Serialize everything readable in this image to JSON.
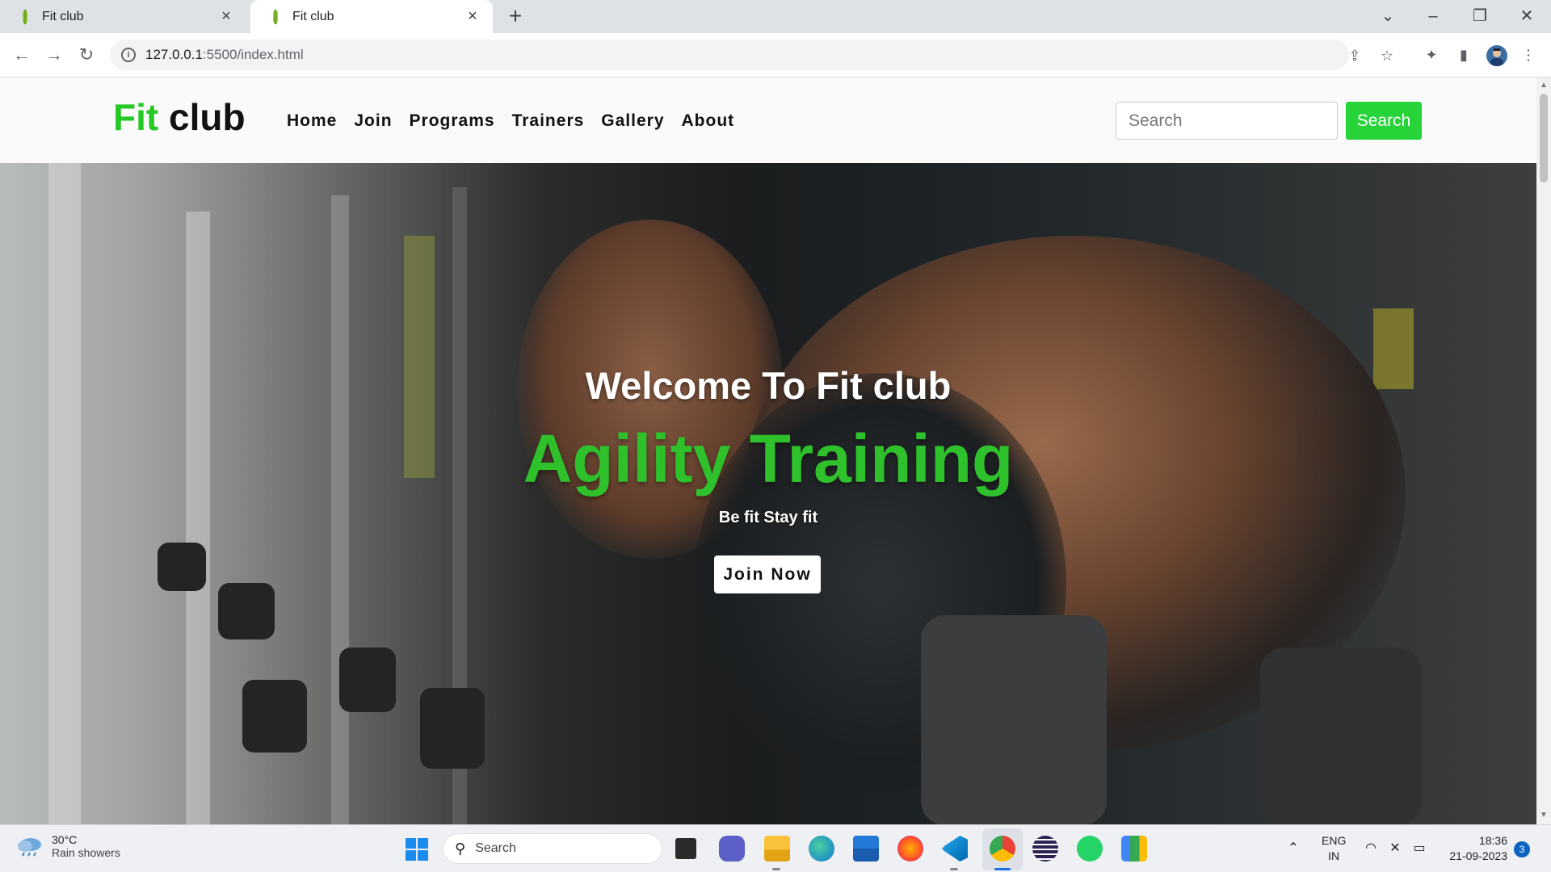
{
  "browser": {
    "tabs": [
      {
        "title": "Fit club",
        "active": false
      },
      {
        "title": "Fit club",
        "active": true
      }
    ],
    "url_host": "127.0.0.1",
    "url_path": ":5500/index.html"
  },
  "site": {
    "logo_fit": "Fit",
    "logo_club": "club",
    "nav": [
      "Home",
      "Join",
      "Programs",
      "Trainers",
      "Gallery",
      "About"
    ],
    "search_placeholder": "Search",
    "search_button": "Search",
    "hero": {
      "welcome": "Welcome To Fit club",
      "headline": "Agility Training",
      "tagline": "Be fit Stay fit",
      "cta": "Join Now"
    }
  },
  "taskbar": {
    "weather_temp": "30°C",
    "weather_condition": "Rain showers",
    "search_placeholder": "Search",
    "lang_line1": "ENG",
    "lang_line2": "IN",
    "time": "18:36",
    "date": "21-09-2023",
    "notification_count": "3"
  },
  "colors": {
    "brand_green": "#26c826",
    "search_button_bg": "#26d43a",
    "headline_green": "#2fc12c"
  }
}
